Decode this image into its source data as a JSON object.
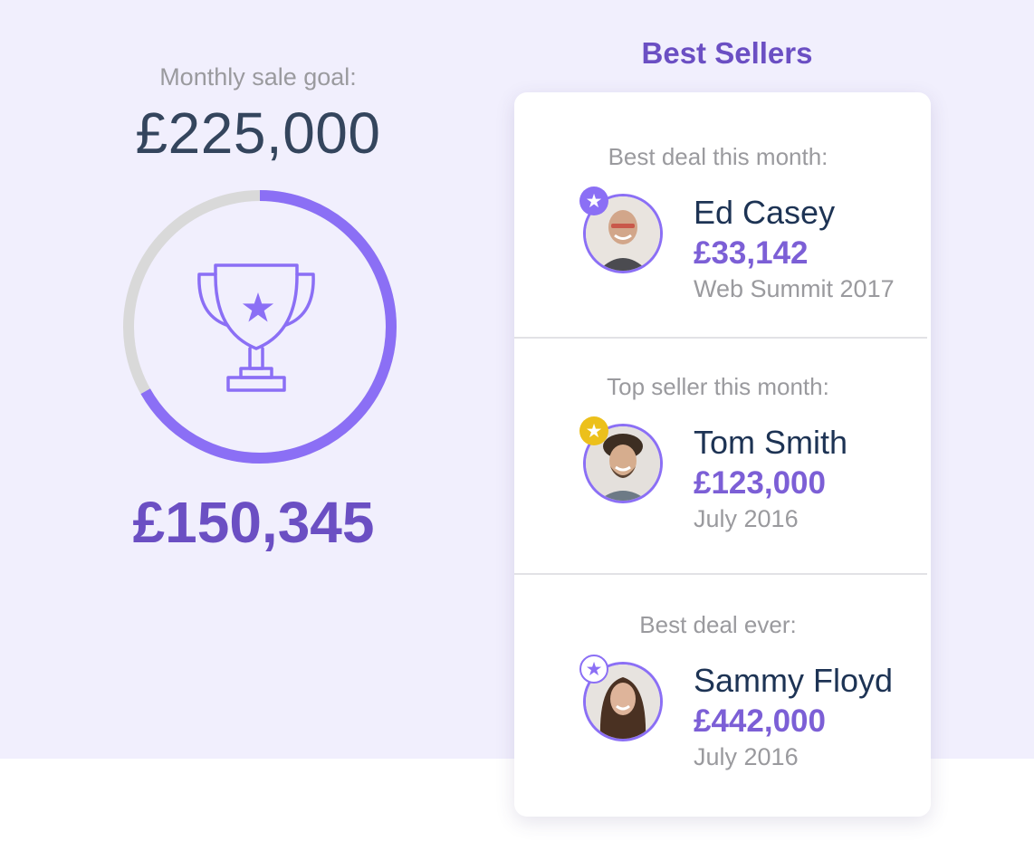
{
  "goal": {
    "label": "Monthly sale goal:",
    "target": "£225,000",
    "current": "£150,345",
    "progress_fraction": 0.668
  },
  "colors": {
    "accent": "#8b6ff5",
    "accent_dark": "#6b4fc3",
    "track": "#d9d9d9",
    "gold": "#ecc01b",
    "background": "#f1effd"
  },
  "best_sellers": {
    "title": "Best Sellers",
    "entries": [
      {
        "caption": "Best deal this month:",
        "name": "Ed Casey",
        "amount": "£33,142",
        "detail": "Web Summit 2017",
        "badge": "purple-star-icon"
      },
      {
        "caption": "Top seller this month:",
        "name": "Tom Smith",
        "amount": "£123,000",
        "detail": "July 2016",
        "badge": "gold-star-icon"
      },
      {
        "caption": "Best deal ever:",
        "name": "Sammy Floyd",
        "amount": "£442,000",
        "detail": "July 2016",
        "badge": "outline-star-icon"
      }
    ]
  }
}
